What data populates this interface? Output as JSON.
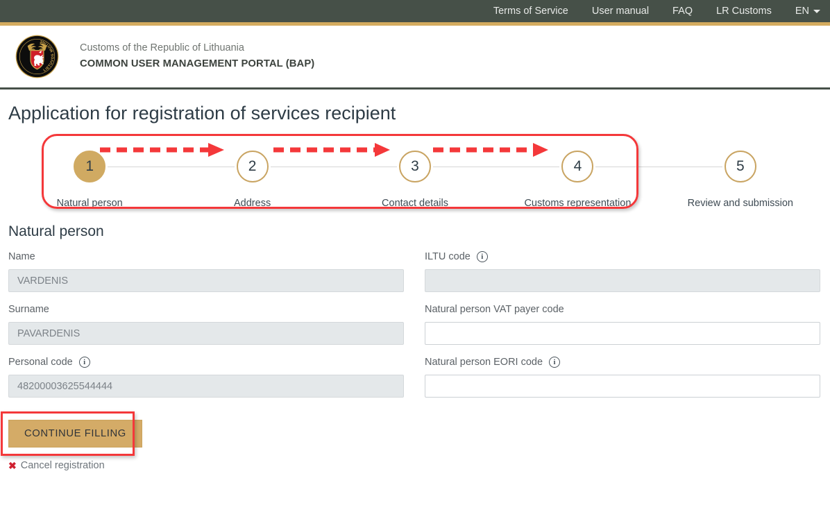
{
  "topbar": {
    "links": [
      {
        "label": "Terms of Service"
      },
      {
        "label": "User manual"
      },
      {
        "label": "FAQ"
      },
      {
        "label": "LR Customs"
      }
    ],
    "language": "EN"
  },
  "header": {
    "organization": "Customs of the Republic of Lithuania",
    "portal": "COMMON USER MANAGEMENT PORTAL (BAP)",
    "logo_ring_text": "LIETUVOS MUITINĖ"
  },
  "page": {
    "title": "Application for registration of services recipient",
    "section_title": "Natural person"
  },
  "stepper": {
    "steps": [
      {
        "number": "1",
        "label": "Natural person",
        "state": "active"
      },
      {
        "number": "2",
        "label": "Address",
        "state": "pending"
      },
      {
        "number": "3",
        "label": "Contact details",
        "state": "pending"
      },
      {
        "number": "4",
        "label": "Customs representation",
        "state": "pending"
      },
      {
        "number": "5",
        "label": "Review and submission",
        "state": "pending"
      }
    ]
  },
  "form": {
    "left": [
      {
        "label": "Name",
        "value": "VARDENIS",
        "placeholder": "",
        "disabled": true,
        "info": false
      },
      {
        "label": "Surname",
        "value": "PAVARDENIS",
        "placeholder": "",
        "disabled": true,
        "info": false
      },
      {
        "label": "Personal code",
        "value": "48200003625544444",
        "placeholder": "",
        "disabled": true,
        "info": true
      }
    ],
    "right": [
      {
        "label": "ILTU code",
        "value": "",
        "placeholder": "",
        "disabled": true,
        "info": true
      },
      {
        "label": "Natural person VAT payer code",
        "value": "",
        "placeholder": "",
        "disabled": false,
        "info": false
      },
      {
        "label": "Natural person EORI code",
        "value": "",
        "placeholder": "",
        "disabled": false,
        "info": true
      }
    ]
  },
  "actions": {
    "continue_label": "CONTINUE FILLING",
    "cancel_label": "Cancel registration",
    "cancel_icon": "x-mark"
  },
  "colors": {
    "topbar_bg": "#465048",
    "gold_accent": "#d4ab5f",
    "step_active": "#d0aa62",
    "step_ring": "#c9a462",
    "button_bg": "#d4ab67",
    "annotation_red": "#f4383a",
    "cancel_red": "#cf2030",
    "disabled_field_bg": "#e4e8ea"
  },
  "annotations": {
    "stepper_highlight": "red-rounded-rectangle",
    "button_highlight": "red-rectangle",
    "arrows": [
      "step1-to-step2",
      "step2-to-step3",
      "step3-to-step4"
    ]
  }
}
